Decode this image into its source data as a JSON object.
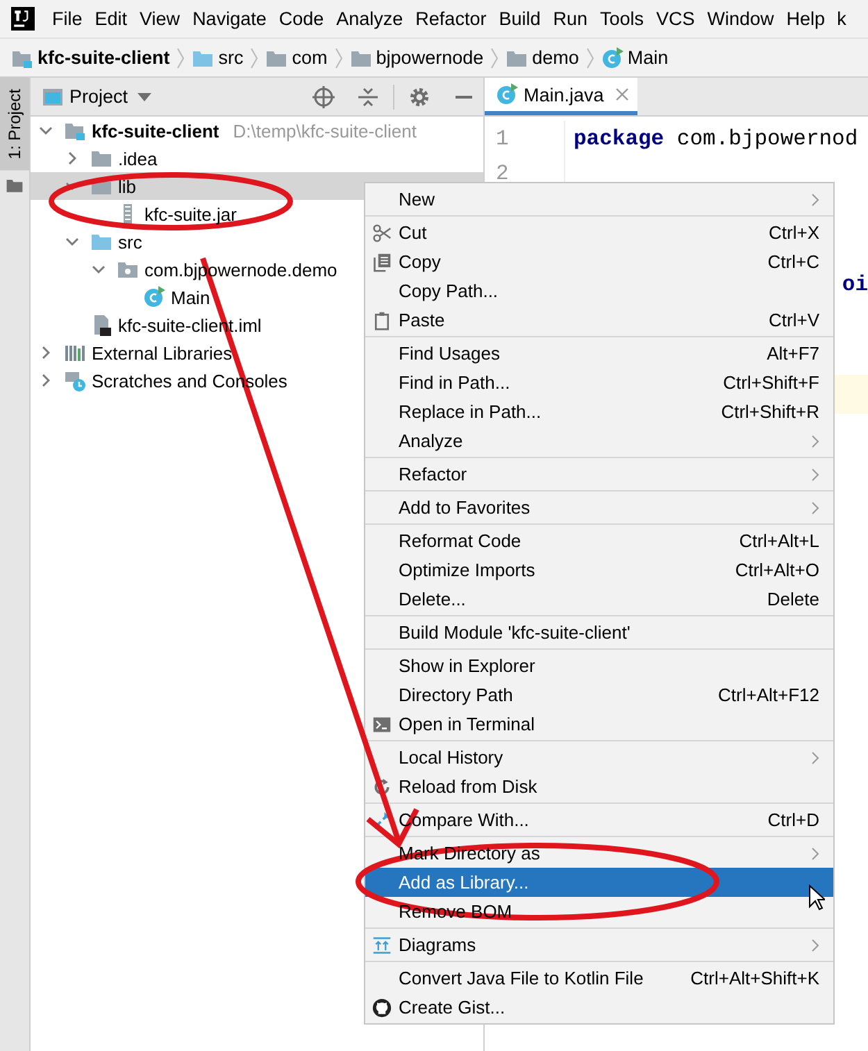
{
  "menu_bar": {
    "items": [
      "File",
      "Edit",
      "View",
      "Navigate",
      "Code",
      "Analyze",
      "Refactor",
      "Build",
      "Run",
      "Tools",
      "VCS",
      "Window",
      "Help"
    ],
    "title_fragment": "k"
  },
  "breadcrumbs": [
    {
      "label": "kfc-suite-client",
      "kind": "module"
    },
    {
      "label": "src",
      "kind": "source-folder"
    },
    {
      "label": "com",
      "kind": "folder"
    },
    {
      "label": "bjpowernode",
      "kind": "folder"
    },
    {
      "label": "demo",
      "kind": "folder"
    },
    {
      "label": "Main",
      "kind": "class"
    }
  ],
  "side_strip": {
    "label": "1: Project"
  },
  "project_panel": {
    "title": "Project",
    "tree": [
      {
        "label": "kfc-suite-client",
        "kind": "module",
        "hint": "D:\\temp\\kfc-suite-client",
        "expanded": true,
        "selected": false,
        "children": [
          {
            "label": ".idea",
            "kind": "folder",
            "expanded": false,
            "selected": false
          },
          {
            "label": "lib",
            "kind": "folder",
            "expanded": true,
            "selected": true,
            "children": [
              {
                "label": "kfc-suite.jar",
                "kind": "jar",
                "selected": false
              }
            ]
          },
          {
            "label": "src",
            "kind": "source-folder",
            "expanded": true,
            "selected": false,
            "children": [
              {
                "label": "com.bjpowernode.demo",
                "kind": "package",
                "expanded": true,
                "selected": false,
                "children": [
                  {
                    "label": "Main",
                    "kind": "class",
                    "selected": false
                  }
                ]
              }
            ]
          },
          {
            "label": "kfc-suite-client.iml",
            "kind": "iml",
            "selected": false
          }
        ]
      },
      {
        "label": "External Libraries",
        "kind": "libraries",
        "expanded": false,
        "selected": false
      },
      {
        "label": "Scratches and Consoles",
        "kind": "scratches",
        "expanded": false,
        "selected": false
      }
    ]
  },
  "editor": {
    "tabs": [
      {
        "label": "Main.java",
        "selected": true
      }
    ],
    "lines": [
      {
        "number": "1",
        "text": "package com.bjpowernod"
      },
      {
        "number": "2"
      }
    ],
    "fragment": "oi"
  },
  "context_menu": {
    "groups": [
      [
        {
          "label": "New",
          "submenu": true,
          "selected": false
        }
      ],
      [
        {
          "label": "Cut",
          "shortcut": "Ctrl+X",
          "submenu": false,
          "selected": false
        },
        {
          "label": "Copy",
          "shortcut": "Ctrl+C",
          "submenu": false,
          "selected": false
        },
        {
          "label": "Copy Path...",
          "submenu": false,
          "selected": false
        },
        {
          "label": "Paste",
          "shortcut": "Ctrl+V",
          "submenu": false,
          "selected": false
        }
      ],
      [
        {
          "label": "Find Usages",
          "shortcut": "Alt+F7",
          "submenu": false,
          "selected": false
        },
        {
          "label": "Find in Path...",
          "shortcut": "Ctrl+Shift+F",
          "submenu": false,
          "selected": false
        },
        {
          "label": "Replace in Path...",
          "shortcut": "Ctrl+Shift+R",
          "submenu": false,
          "selected": false
        },
        {
          "label": "Analyze",
          "submenu": true,
          "selected": false
        }
      ],
      [
        {
          "label": "Refactor",
          "submenu": true,
          "selected": false
        }
      ],
      [
        {
          "label": "Add to Favorites",
          "submenu": true,
          "selected": false
        }
      ],
      [
        {
          "label": "Reformat Code",
          "shortcut": "Ctrl+Alt+L",
          "submenu": false,
          "selected": false
        },
        {
          "label": "Optimize Imports",
          "shortcut": "Ctrl+Alt+O",
          "submenu": false,
          "selected": false
        },
        {
          "label": "Delete...",
          "shortcut": "Delete",
          "submenu": false,
          "selected": false
        }
      ],
      [
        {
          "label": "Build Module 'kfc-suite-client'",
          "submenu": false,
          "selected": false
        }
      ],
      [
        {
          "label": "Show in Explorer",
          "submenu": false,
          "selected": false
        },
        {
          "label": "Directory Path",
          "shortcut": "Ctrl+Alt+F12",
          "submenu": false,
          "selected": false
        },
        {
          "label": "Open in Terminal",
          "submenu": false,
          "selected": false
        }
      ],
      [
        {
          "label": "Local History",
          "submenu": true,
          "selected": false
        },
        {
          "label": "Reload from Disk",
          "submenu": false,
          "selected": false
        }
      ],
      [
        {
          "label": "Compare With...",
          "shortcut": "Ctrl+D",
          "submenu": false,
          "selected": false
        }
      ],
      [
        {
          "label": "Mark Directory as",
          "submenu": true,
          "selected": false
        },
        {
          "label": "Add as Library...",
          "submenu": false,
          "selected": true
        },
        {
          "label": "Remove BOM",
          "submenu": false,
          "selected": false
        }
      ],
      [
        {
          "label": "Diagrams",
          "submenu": true,
          "selected": false
        }
      ],
      [
        {
          "label": "Convert Java File to Kotlin File",
          "shortcut": "Ctrl+Alt+Shift+K",
          "submenu": false,
          "selected": false
        },
        {
          "label": "Create Gist...",
          "submenu": false,
          "selected": false
        }
      ]
    ]
  }
}
